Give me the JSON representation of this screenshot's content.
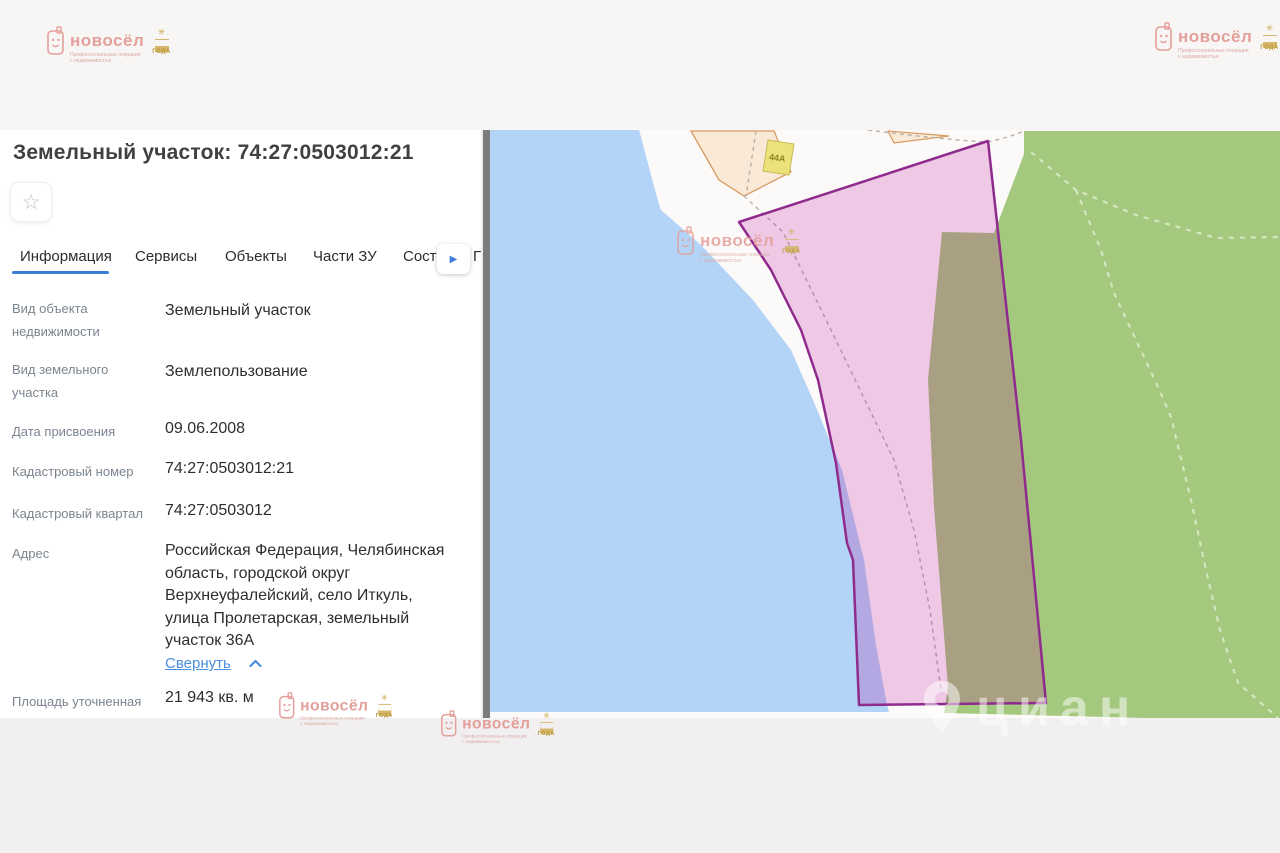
{
  "watermark": {
    "brand": "новосёл",
    "tagline_line1": "Профессиональные операции",
    "tagline_line2": "с недвижимостью",
    "award_star": "✳",
    "award_word": "ГОДА"
  },
  "panel": {
    "title": "Земельный участок: 74:27:0503012:21",
    "star_icon": "☆",
    "tabs": [
      {
        "label": "Информация",
        "active": true
      },
      {
        "label": "Сервисы",
        "active": false
      },
      {
        "label": "Объекты",
        "active": false
      },
      {
        "label": "Части ЗУ",
        "active": false
      },
      {
        "label": "Соста",
        "active": false
      }
    ],
    "tab_partial": "Г",
    "next_tabs_arrow": "▶",
    "fields": [
      {
        "label": "Вид объекта недвижимости",
        "value": "Земельный участок"
      },
      {
        "label": "Вид земельного участка",
        "value": "Землепользование"
      },
      {
        "label": "Дата присвоения",
        "value": "09.06.2008"
      },
      {
        "label": "Кадастровый номер",
        "value": "74:27:0503012:21"
      },
      {
        "label": "Кадастровый квартал",
        "value": "74:27:0503012"
      },
      {
        "label": "Адрес",
        "value": "Российская Федерация, Челябинская область, городской округ Верхнеуфалейский, село Иткуль, улица Пролетарская, земельный участок 36А"
      },
      {
        "label": "Площадь уточненная",
        "value": "21 943 кв. м"
      }
    ],
    "collapse_link": "Свернуть"
  },
  "map": {
    "building_label": "44A",
    "cian_watermark": "циан",
    "colors": {
      "water": "#b3d3f7",
      "forest": "#a5c87f",
      "land": "#fcfaf9",
      "plot_fill": "rgba(184,0,150,0.2)",
      "plot_border": "#8e2b8d",
      "parcel_peach": "#f9e9d6",
      "parcel_border": "#d89a5f",
      "building_yellow": "#ebe27b",
      "trail": "#d4e6bd",
      "cadastral_dash": "#b7b0a8",
      "accent_blue": "#3a7fd5",
      "link_blue": "#4a8fe0",
      "brand_pink": "#e49f9a",
      "award_gold": "#c3a04b"
    }
  }
}
